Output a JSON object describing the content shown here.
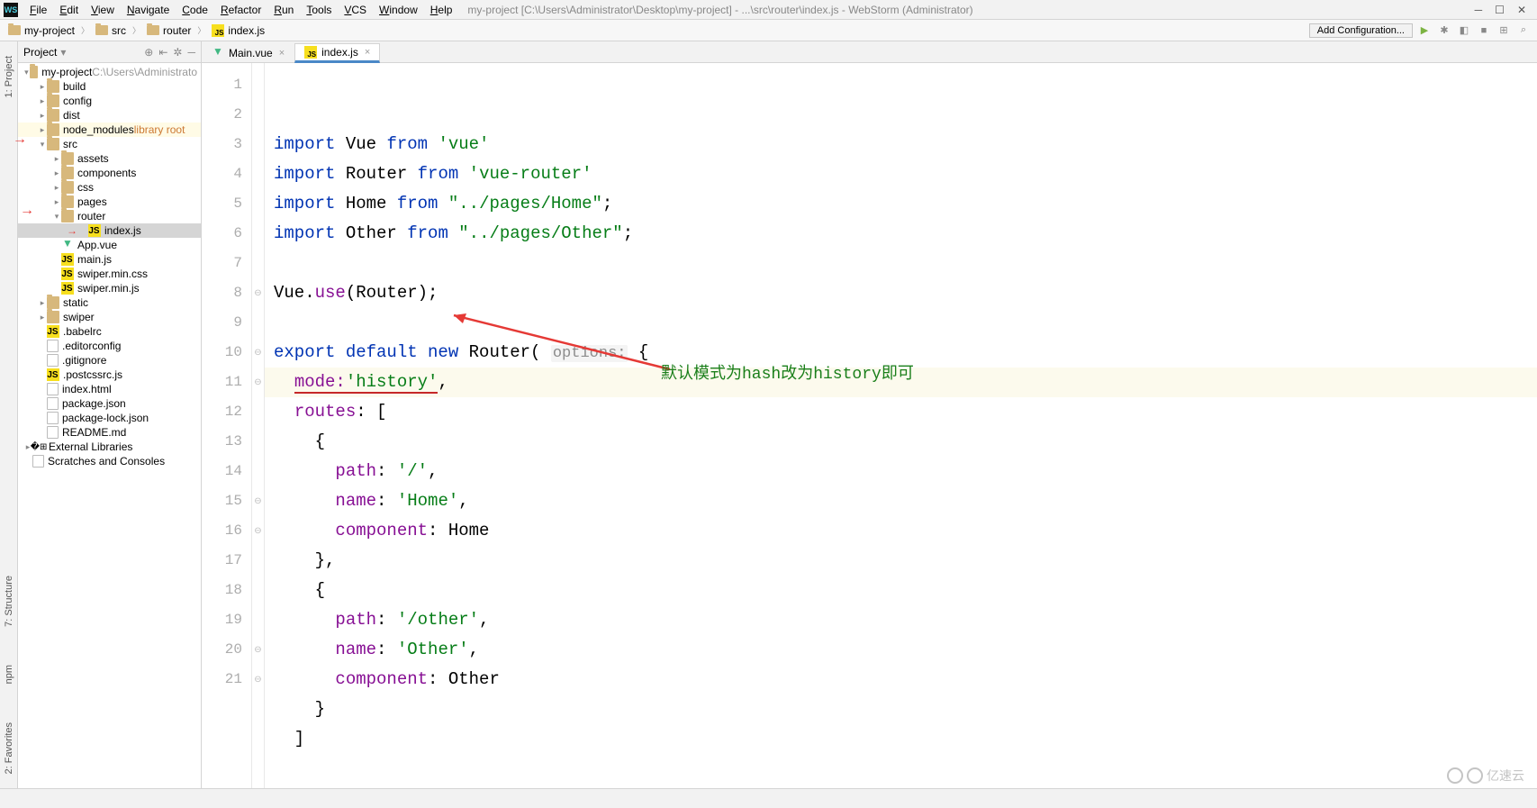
{
  "menu": [
    "File",
    "Edit",
    "View",
    "Navigate",
    "Code",
    "Refactor",
    "Run",
    "Tools",
    "VCS",
    "Window",
    "Help"
  ],
  "window_title": "my-project [C:\\Users\\Administrator\\Desktop\\my-project] - ...\\src\\router\\index.js - WebStorm (Administrator)",
  "breadcrumbs": [
    {
      "icon": "folder",
      "label": "my-project"
    },
    {
      "icon": "folder",
      "label": "src"
    },
    {
      "icon": "folder",
      "label": "router"
    },
    {
      "icon": "js",
      "label": "index.js"
    }
  ],
  "add_config_label": "Add Configuration...",
  "side_tabs_left": [
    "1: Project",
    "7: Structure",
    "npm",
    "2: Favorites"
  ],
  "project_panel": {
    "title": "Project",
    "tree": [
      {
        "d": 0,
        "arrow": "v",
        "icon": "folder",
        "label": "my-project",
        "suffix": " C:\\Users\\Administrato",
        "gray": true
      },
      {
        "d": 1,
        "arrow": ">",
        "icon": "folder",
        "label": "build"
      },
      {
        "d": 1,
        "arrow": ">",
        "icon": "folder",
        "label": "config"
      },
      {
        "d": 1,
        "arrow": ">",
        "icon": "folder",
        "label": "dist"
      },
      {
        "d": 1,
        "arrow": ">",
        "icon": "folder",
        "label": "node_modules",
        "suffix": " library root",
        "lib": true
      },
      {
        "d": 1,
        "arrow": "v",
        "icon": "folder",
        "label": "src",
        "mark": "red-arrow-left"
      },
      {
        "d": 2,
        "arrow": ">",
        "icon": "folder",
        "label": "assets"
      },
      {
        "d": 2,
        "arrow": ">",
        "icon": "folder",
        "label": "components"
      },
      {
        "d": 2,
        "arrow": ">",
        "icon": "folder",
        "label": "css"
      },
      {
        "d": 2,
        "arrow": ">",
        "icon": "folder",
        "label": "pages"
      },
      {
        "d": 2,
        "arrow": "v",
        "icon": "folder",
        "label": "router",
        "mark": "red-arrow-left"
      },
      {
        "d": 3,
        "arrow": "",
        "icon": "js",
        "label": "index.js",
        "sel": true,
        "mark": "red-arrow-inline"
      },
      {
        "d": 2,
        "arrow": "",
        "icon": "vue",
        "label": "App.vue"
      },
      {
        "d": 2,
        "arrow": "",
        "icon": "js",
        "label": "main.js"
      },
      {
        "d": 2,
        "arrow": "",
        "icon": "js",
        "label": "swiper.min.css"
      },
      {
        "d": 2,
        "arrow": "",
        "icon": "js",
        "label": "swiper.min.js"
      },
      {
        "d": 1,
        "arrow": ">",
        "icon": "folder",
        "label": "static"
      },
      {
        "d": 1,
        "arrow": ">",
        "icon": "folder",
        "label": "swiper"
      },
      {
        "d": 1,
        "arrow": "",
        "icon": "js",
        "label": ".babelrc"
      },
      {
        "d": 1,
        "arrow": "",
        "icon": "file",
        "label": ".editorconfig"
      },
      {
        "d": 1,
        "arrow": "",
        "icon": "file",
        "label": ".gitignore"
      },
      {
        "d": 1,
        "arrow": "",
        "icon": "js",
        "label": ".postcssrc.js"
      },
      {
        "d": 1,
        "arrow": "",
        "icon": "file",
        "label": "index.html"
      },
      {
        "d": 1,
        "arrow": "",
        "icon": "file",
        "label": "package.json"
      },
      {
        "d": 1,
        "arrow": "",
        "icon": "file",
        "label": "package-lock.json"
      },
      {
        "d": 1,
        "arrow": "",
        "icon": "file",
        "label": "README.md"
      },
      {
        "d": 0,
        "arrow": ">",
        "icon": "lib",
        "label": "External Libraries"
      },
      {
        "d": 0,
        "arrow": "",
        "icon": "file",
        "label": "Scratches and Consoles"
      }
    ]
  },
  "tabs": [
    {
      "icon": "vue",
      "label": "Main.vue",
      "active": false
    },
    {
      "icon": "js",
      "label": "index.js",
      "active": true
    }
  ],
  "code_lines": [
    {
      "n": 1,
      "segs": [
        {
          "t": "import ",
          "c": "kw"
        },
        {
          "t": "Vue ",
          "c": "ident"
        },
        {
          "t": "from ",
          "c": "kw"
        },
        {
          "t": "'vue'",
          "c": "str"
        }
      ]
    },
    {
      "n": 2,
      "segs": [
        {
          "t": "import ",
          "c": "kw"
        },
        {
          "t": "Router ",
          "c": "ident"
        },
        {
          "t": "from ",
          "c": "kw"
        },
        {
          "t": "'vue-router'",
          "c": "str"
        }
      ]
    },
    {
      "n": 3,
      "segs": [
        {
          "t": "import ",
          "c": "kw"
        },
        {
          "t": "Home ",
          "c": "ident"
        },
        {
          "t": "from ",
          "c": "kw"
        },
        {
          "t": "\"../pages/Home\"",
          "c": "str"
        },
        {
          "t": ";",
          "c": "ident"
        }
      ]
    },
    {
      "n": 4,
      "segs": [
        {
          "t": "import ",
          "c": "kw"
        },
        {
          "t": "Other ",
          "c": "ident"
        },
        {
          "t": "from ",
          "c": "kw"
        },
        {
          "t": "\"../pages/Other\"",
          "c": "str"
        },
        {
          "t": ";",
          "c": "ident"
        }
      ]
    },
    {
      "n": 5,
      "segs": []
    },
    {
      "n": 6,
      "segs": [
        {
          "t": "Vue.",
          "c": "ident"
        },
        {
          "t": "use",
          "c": "prop"
        },
        {
          "t": "(Router);",
          "c": "ident"
        }
      ]
    },
    {
      "n": 7,
      "segs": []
    },
    {
      "n": 8,
      "mark": "⊖",
      "segs": [
        {
          "t": "export default new ",
          "c": "kw"
        },
        {
          "t": "Router( ",
          "c": "ident"
        },
        {
          "t": "options:",
          "c": "hint"
        },
        {
          "t": " {",
          "c": "ident"
        }
      ]
    },
    {
      "n": 9,
      "hl": true,
      "segs": [
        {
          "t": "  ",
          "c": ""
        },
        {
          "t": "mode:",
          "c": "prop",
          "wavy": true
        },
        {
          "t": "'history'",
          "c": "str",
          "wavy": true
        },
        {
          "t": ",",
          "c": "ident"
        }
      ]
    },
    {
      "n": 10,
      "mark": "⊖",
      "segs": [
        {
          "t": "  ",
          "c": ""
        },
        {
          "t": "routes",
          "c": "prop"
        },
        {
          "t": ": [",
          "c": "ident"
        }
      ]
    },
    {
      "n": 11,
      "mark": "⊖",
      "segs": [
        {
          "t": "    {",
          "c": "ident"
        }
      ]
    },
    {
      "n": 12,
      "segs": [
        {
          "t": "      ",
          "c": ""
        },
        {
          "t": "path",
          "c": "prop"
        },
        {
          "t": ": ",
          "c": "ident"
        },
        {
          "t": "'/'",
          "c": "str"
        },
        {
          "t": ",",
          "c": "ident"
        }
      ]
    },
    {
      "n": 13,
      "segs": [
        {
          "t": "      ",
          "c": ""
        },
        {
          "t": "name",
          "c": "prop"
        },
        {
          "t": ": ",
          "c": "ident"
        },
        {
          "t": "'Home'",
          "c": "str"
        },
        {
          "t": ",",
          "c": "ident"
        }
      ]
    },
    {
      "n": 14,
      "segs": [
        {
          "t": "      ",
          "c": ""
        },
        {
          "t": "component",
          "c": "prop"
        },
        {
          "t": ": Home",
          "c": "ident"
        }
      ]
    },
    {
      "n": 15,
      "mark": "⊖",
      "segs": [
        {
          "t": "    },",
          "c": "ident"
        }
      ]
    },
    {
      "n": 16,
      "mark": "⊖",
      "segs": [
        {
          "t": "    {",
          "c": "ident"
        }
      ]
    },
    {
      "n": 17,
      "segs": [
        {
          "t": "      ",
          "c": ""
        },
        {
          "t": "path",
          "c": "prop"
        },
        {
          "t": ": ",
          "c": "ident"
        },
        {
          "t": "'/other'",
          "c": "str"
        },
        {
          "t": ",",
          "c": "ident"
        }
      ]
    },
    {
      "n": 18,
      "segs": [
        {
          "t": "      ",
          "c": ""
        },
        {
          "t": "name",
          "c": "prop"
        },
        {
          "t": ": ",
          "c": "ident"
        },
        {
          "t": "'Other'",
          "c": "str"
        },
        {
          "t": ",",
          "c": "ident"
        }
      ]
    },
    {
      "n": 19,
      "segs": [
        {
          "t": "      ",
          "c": ""
        },
        {
          "t": "component",
          "c": "prop"
        },
        {
          "t": ": Other",
          "c": "ident"
        }
      ]
    },
    {
      "n": 20,
      "mark": "⊖",
      "segs": [
        {
          "t": "    }",
          "c": "ident"
        }
      ]
    },
    {
      "n": 21,
      "mark": "⊖",
      "segs": [
        {
          "t": "  ]",
          "c": "ident"
        }
      ]
    }
  ],
  "annotation_text": "默认模式为hash改为history即可",
  "corner_logo": "亿速云"
}
